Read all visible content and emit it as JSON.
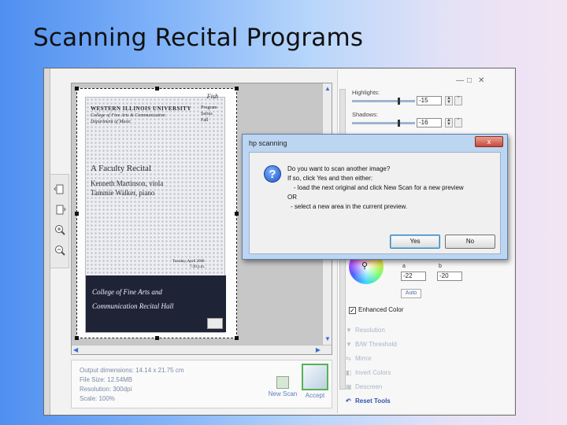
{
  "slide": {
    "title": "Scanning Recital Programs"
  },
  "preview": {
    "document": {
      "corner_note": "Fish",
      "university_name": "WESTERN ILLINOIS UNIVERSITY",
      "college_lines": [
        "College of Fine Arts & Communication",
        "Department of Music"
      ],
      "right_lines": [
        "Program",
        "Series",
        "Fall"
      ],
      "title": "A Faculty Recital",
      "performers": [
        "Kenneth Martinson, viola",
        "Tammie Walker, piano"
      ],
      "date_lines": [
        "Tuesday, April 2008",
        "7:30 p.m."
      ],
      "venue_lines": [
        "College of Fine Arts and",
        "Communication Recital Hall"
      ]
    }
  },
  "info": {
    "output_dimensions": "Output dimensions: 14.14 x 21.75 cm",
    "file_size": "File Size: 12.54MB",
    "resolution": "Resolution: 300dpi",
    "scale": "Scale: 100%",
    "new_scan_label": "New Scan",
    "accept_label": "Accept"
  },
  "right_panel": {
    "highlights_label": "Highlights:",
    "highlights_value": "-15",
    "shadows_label": "Shadows:",
    "shadows_value": "-16",
    "a_label": "a",
    "a_value": "-22",
    "b_label": "b",
    "b_value": "-20",
    "auto_label": "Auto",
    "enhanced_color_label": "Enhanced Color",
    "tools": [
      "Resolution",
      "B/W Threshold",
      "Mirror",
      "Invert Colors",
      "Descreen",
      "Reset Tools"
    ]
  },
  "window_controls": {
    "minimize": "—",
    "maximize": "□",
    "close": "✕"
  },
  "dialog": {
    "title": "hp scanning",
    "close_label": "x",
    "icon": "question-icon",
    "message_lines": [
      "Do you want to scan another image?",
      "If so, click Yes and then either:",
      "- load the next original and click New Scan for a new preview",
      "OR",
      "- select a new area in the current preview."
    ],
    "yes_label": "Yes",
    "no_label": "No"
  },
  "colors": {
    "accent": "#2f57a6",
    "accept_border": "#57b255",
    "dialog_frame": "#bcd5f1"
  }
}
